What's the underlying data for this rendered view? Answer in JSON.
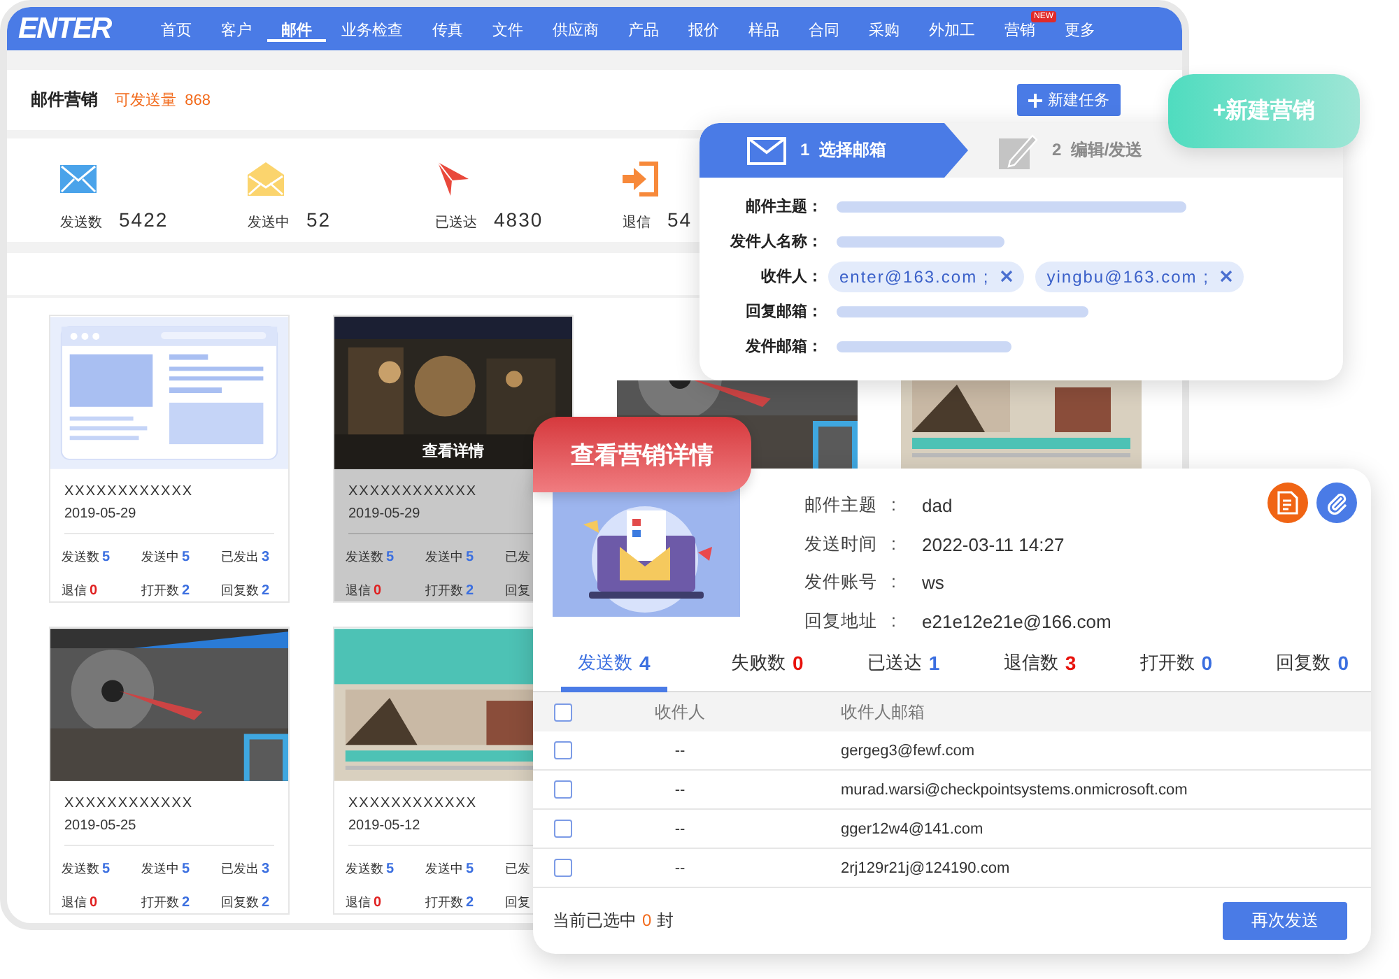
{
  "nav": {
    "logo": "ENTER",
    "items": [
      {
        "label": "首页",
        "selected": false
      },
      {
        "label": "客户",
        "selected": false
      },
      {
        "label": "邮件",
        "selected": true
      },
      {
        "label": "业务检查",
        "selected": false
      },
      {
        "label": "传真",
        "selected": false
      },
      {
        "label": "文件",
        "selected": false
      },
      {
        "label": "供应商",
        "selected": false
      },
      {
        "label": "产品",
        "selected": false
      },
      {
        "label": "报价",
        "selected": false
      },
      {
        "label": "样品",
        "selected": false
      },
      {
        "label": "合同",
        "selected": false
      },
      {
        "label": "采购",
        "selected": false
      },
      {
        "label": "外加工",
        "selected": false
      },
      {
        "label": "营销",
        "selected": false,
        "badge": "NEW"
      },
      {
        "label": "更多",
        "selected": false
      }
    ]
  },
  "header": {
    "title": "邮件营销",
    "quota_label": "可发送量",
    "quota": "868",
    "button": "新建任务"
  },
  "stats": [
    {
      "kind": "sent",
      "label": "发送数",
      "value": "5422"
    },
    {
      "kind": "sending",
      "label": "发送中",
      "value": "52"
    },
    {
      "kind": "delivered",
      "label": "已送达",
      "value": "4830"
    },
    {
      "kind": "bounced",
      "label": "退信",
      "value": "54"
    }
  ],
  "cards": [
    {
      "highlighted": false,
      "title": "XXXXXXXXXXXX",
      "date": "2019-05-29",
      "stats": [
        {
          "label": "发送数",
          "value": "5",
          "color": "#3b6fe0"
        },
        {
          "label": "发送中",
          "value": "5",
          "color": "#3b6fe0"
        },
        {
          "label": "已发出",
          "value": "3",
          "color": "#3b6fe0"
        },
        {
          "label": "退信",
          "value": "0",
          "color": "#e02020"
        },
        {
          "label": "打开数",
          "value": "2",
          "color": "#3b6fe0"
        },
        {
          "label": "回复数",
          "value": "2",
          "color": "#3b6fe0"
        }
      ]
    },
    {
      "highlighted": true,
      "title": "XXXXXXXXXXXX",
      "date": "2019-05-29",
      "stats": [
        {
          "label": "发送数",
          "value": "5",
          "color": "#3b6fe0"
        },
        {
          "label": "发送中",
          "value": "5",
          "color": "#3b6fe0"
        },
        {
          "label": "已发"
        },
        {
          "label": "退信",
          "value": "0",
          "color": "#e02020"
        },
        {
          "label": "打开数",
          "value": "2",
          "color": "#3b6fe0"
        },
        {
          "label": "回复"
        }
      ]
    },
    {
      "highlighted": false,
      "title": "XXXXXXXXXXXX",
      "date": "2019-05-25",
      "stats": [
        {
          "label": "发送数",
          "value": "5",
          "color": "#3b6fe0"
        },
        {
          "label": "发送中",
          "value": "5",
          "color": "#3b6fe0"
        },
        {
          "label": "已发出",
          "value": "3",
          "color": "#3b6fe0"
        },
        {
          "label": "退信",
          "value": "0",
          "color": "#e02020"
        },
        {
          "label": "打开数",
          "value": "2",
          "color": "#3b6fe0"
        },
        {
          "label": "回复数",
          "value": "2",
          "color": "#3b6fe0"
        }
      ]
    },
    {
      "highlighted": false,
      "title": "XXXXXXXXXXXX",
      "date": "2019-05-12",
      "stats": [
        {
          "label": "发送数",
          "value": "5",
          "color": "#3b6fe0"
        },
        {
          "label": "发送中",
          "value": "5",
          "color": "#3b6fe0"
        },
        {
          "label": "已发"
        },
        {
          "label": "退信",
          "value": "0",
          "color": "#e02020"
        },
        {
          "label": "打开数",
          "value": "2",
          "color": "#3b6fe0"
        },
        {
          "label": "回复"
        }
      ]
    }
  ],
  "card_hover_label": "查看详情",
  "new_campaign": {
    "label": "+新建营销"
  },
  "wizard": {
    "steps": [
      {
        "number": "1",
        "label": "选择邮箱",
        "selected": true
      },
      {
        "number": "2",
        "label": "编辑/发送",
        "selected": false
      }
    ],
    "fields": [
      {
        "kind": "bar",
        "label": "邮件主题："
      },
      {
        "kind": "bar",
        "label": "发件人名称："
      },
      {
        "kind": "tags",
        "label": "收件人：",
        "tags": [
          "enter@163.com ;",
          "yingbu@163.com ;"
        ]
      },
      {
        "kind": "bar",
        "label": "回复邮箱："
      },
      {
        "kind": "bar",
        "label": "发件邮箱："
      }
    ]
  },
  "detail": {
    "ribbon": "查看营销详情",
    "info": [
      {
        "label": "邮件主题",
        "colon": ":",
        "value": "dad"
      },
      {
        "label": "发送时间",
        "colon": ":",
        "value": "2022-03-11 14:27"
      },
      {
        "label": "发件账号",
        "colon": ":",
        "value": "ws"
      },
      {
        "label": "回复地址",
        "colon": ":",
        "value": "e21e12e21e@166.com"
      }
    ],
    "tabs": [
      {
        "label": "发送数",
        "count": "4",
        "color": "#3b6fe0",
        "selected": true
      },
      {
        "label": "失败数",
        "count": "0",
        "color": "#e8120c",
        "selected": false
      },
      {
        "label": "已送达",
        "count": "1",
        "color": "#3b6fe0",
        "selected": false
      },
      {
        "label": "退信数",
        "count": "3",
        "color": "#e8120c",
        "selected": false
      },
      {
        "label": "打开数",
        "count": "0",
        "color": "#3b6fe0",
        "selected": false
      },
      {
        "label": "回复数",
        "count": "0",
        "color": "#3b6fe0",
        "selected": false
      }
    ],
    "table": {
      "header_checked": false,
      "columns": [
        "收件人",
        "收件人邮箱"
      ],
      "rows": [
        {
          "checked": false,
          "recipient": "--",
          "email": "gergeg3@fewf.com"
        },
        {
          "checked": false,
          "recipient": "--",
          "email": "murad.warsi@checkpointsystems.onmicrosoft.com"
        },
        {
          "checked": false,
          "recipient": "--",
          "email": "gger12w4@141.com"
        },
        {
          "checked": false,
          "recipient": "--",
          "email": "2rj129r21j@124190.com"
        }
      ]
    },
    "footer": {
      "prefix": "当前已选中",
      "count": "0",
      "suffix": "封"
    },
    "button": "再次发送"
  }
}
